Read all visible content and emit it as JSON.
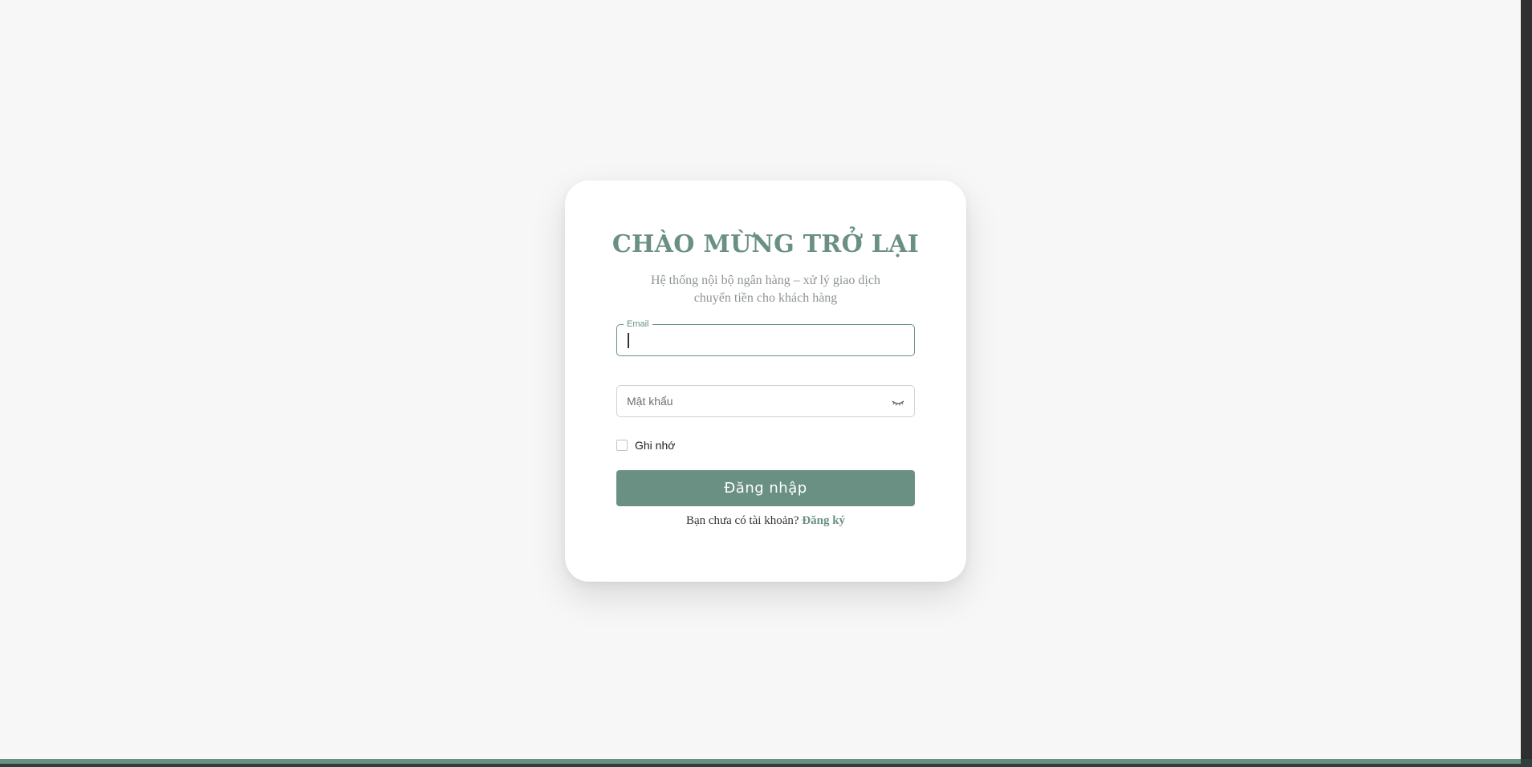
{
  "login": {
    "title": "CHÀO MỪNG TRỞ LẠI",
    "subtitle": "Hệ thống nội bộ ngân hàng – xử lý giao dịch chuyển tiền cho khách hàng",
    "email_label": "Email",
    "email_value": "",
    "password_placeholder": "Mật khẩu",
    "password_value": "",
    "remember_label": "Ghi nhớ",
    "remember_checked": false,
    "submit_label": "Đăng nhập",
    "signup_prompt": "Bạn chưa có tài khoản?",
    "signup_link": "Đăng ký"
  },
  "icons": {
    "password_toggle": "eye-closed-icon"
  },
  "colors": {
    "accent": "#6a9084",
    "background": "#f7f7f7",
    "card": "#ffffff",
    "subtitle": "#8e9592"
  }
}
